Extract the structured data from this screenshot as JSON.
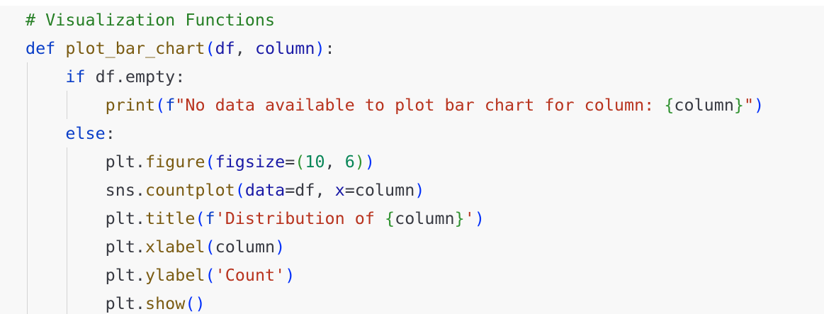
{
  "code": {
    "lines": [
      [
        {
          "t": "# Visualization Functions",
          "c": "t-comment"
        }
      ],
      [
        {
          "t": "def ",
          "c": "t-kw"
        },
        {
          "t": "plot_bar_chart",
          "c": "t-fn"
        },
        {
          "t": "(",
          "c": "t-paren1"
        },
        {
          "t": "df",
          "c": "t-param"
        },
        {
          "t": ", ",
          "c": "t-plain"
        },
        {
          "t": "column",
          "c": "t-param"
        },
        {
          "t": ")",
          "c": "t-paren1"
        },
        {
          "t": ":",
          "c": "t-plain"
        }
      ],
      [
        {
          "t": "    ",
          "c": "t-plain"
        },
        {
          "t": "if ",
          "c": "t-kw"
        },
        {
          "t": "df.empty:",
          "c": "t-plain"
        }
      ],
      [
        {
          "t": "        ",
          "c": "t-plain"
        },
        {
          "t": "print",
          "c": "t-fn"
        },
        {
          "t": "(",
          "c": "t-paren1"
        },
        {
          "t": "f",
          "c": "t-kw"
        },
        {
          "t": "\"No data available to plot bar chart for column: ",
          "c": "t-str"
        },
        {
          "t": "{",
          "c": "t-brace"
        },
        {
          "t": "column",
          "c": "t-plain"
        },
        {
          "t": "}",
          "c": "t-brace"
        },
        {
          "t": "\"",
          "c": "t-str"
        },
        {
          "t": ")",
          "c": "t-paren1"
        }
      ],
      [
        {
          "t": "    ",
          "c": "t-plain"
        },
        {
          "t": "else",
          "c": "t-kw"
        },
        {
          "t": ":",
          "c": "t-plain"
        }
      ],
      [
        {
          "t": "        ",
          "c": "t-plain"
        },
        {
          "t": "plt.",
          "c": "t-plain"
        },
        {
          "t": "figure",
          "c": "t-fn"
        },
        {
          "t": "(",
          "c": "t-paren1"
        },
        {
          "t": "figsize",
          "c": "t-param"
        },
        {
          "t": "=",
          "c": "t-plain"
        },
        {
          "t": "(",
          "c": "t-paren2"
        },
        {
          "t": "10",
          "c": "t-num"
        },
        {
          "t": ", ",
          "c": "t-plain"
        },
        {
          "t": "6",
          "c": "t-num"
        },
        {
          "t": ")",
          "c": "t-paren2"
        },
        {
          "t": ")",
          "c": "t-paren1"
        }
      ],
      [
        {
          "t": "        ",
          "c": "t-plain"
        },
        {
          "t": "sns.",
          "c": "t-plain"
        },
        {
          "t": "countplot",
          "c": "t-fn"
        },
        {
          "t": "(",
          "c": "t-paren1"
        },
        {
          "t": "data",
          "c": "t-param"
        },
        {
          "t": "=df, ",
          "c": "t-plain"
        },
        {
          "t": "x",
          "c": "t-param"
        },
        {
          "t": "=column",
          "c": "t-plain"
        },
        {
          "t": ")",
          "c": "t-paren1"
        }
      ],
      [
        {
          "t": "        ",
          "c": "t-plain"
        },
        {
          "t": "plt.",
          "c": "t-plain"
        },
        {
          "t": "title",
          "c": "t-fn"
        },
        {
          "t": "(",
          "c": "t-paren1"
        },
        {
          "t": "f",
          "c": "t-kw"
        },
        {
          "t": "'Distribution of ",
          "c": "t-str"
        },
        {
          "t": "{",
          "c": "t-brace"
        },
        {
          "t": "column",
          "c": "t-plain"
        },
        {
          "t": "}",
          "c": "t-brace"
        },
        {
          "t": "'",
          "c": "t-str"
        },
        {
          "t": ")",
          "c": "t-paren1"
        }
      ],
      [
        {
          "t": "        ",
          "c": "t-plain"
        },
        {
          "t": "plt.",
          "c": "t-plain"
        },
        {
          "t": "xlabel",
          "c": "t-fn"
        },
        {
          "t": "(",
          "c": "t-paren1"
        },
        {
          "t": "column",
          "c": "t-plain"
        },
        {
          "t": ")",
          "c": "t-paren1"
        }
      ],
      [
        {
          "t": "        ",
          "c": "t-plain"
        },
        {
          "t": "plt.",
          "c": "t-plain"
        },
        {
          "t": "ylabel",
          "c": "t-fn"
        },
        {
          "t": "(",
          "c": "t-paren1"
        },
        {
          "t": "'Count'",
          "c": "t-str"
        },
        {
          "t": ")",
          "c": "t-paren1"
        }
      ],
      [
        {
          "t": "        ",
          "c": "t-plain"
        },
        {
          "t": "plt.",
          "c": "t-plain"
        },
        {
          "t": "show",
          "c": "t-fn"
        },
        {
          "t": "(",
          "c": "t-paren1"
        },
        {
          "t": ")",
          "c": "t-paren1"
        }
      ]
    ]
  },
  "colors": {
    "background": "#f8f8f8",
    "comment": "#267f25",
    "keyword": "#0a3ec8",
    "function": "#7a5b12",
    "string": "#b8331e",
    "number": "#098658",
    "guide": "#d3d3d3"
  }
}
